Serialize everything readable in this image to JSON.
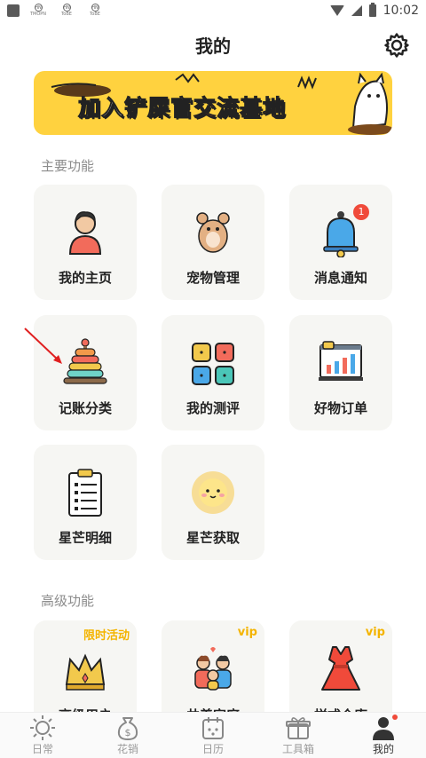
{
  "status_bar": {
    "time": "10:02",
    "mini1": "HN",
    "mini1_label": "TMOPN",
    "mini2": "HN",
    "mini2_label": "ToBE",
    "mini3": "HN",
    "mini3_label": "ToBE"
  },
  "header": {
    "title": "我的"
  },
  "banner": {
    "text_part1": "加入铲屎官",
    "text_part2": "交流基地"
  },
  "sections": {
    "main": "主要功能",
    "advanced": "高级功能"
  },
  "main_items": [
    {
      "label": "我的主页",
      "icon": "user-icon"
    },
    {
      "label": "宠物管理",
      "icon": "hamster-icon"
    },
    {
      "label": "消息通知",
      "icon": "bell-icon",
      "badge": "1"
    },
    {
      "label": "记账分类",
      "icon": "ring-stack-icon"
    },
    {
      "label": "我的测评",
      "icon": "grid-squares-icon"
    },
    {
      "label": "好物订单",
      "icon": "chart-board-icon"
    },
    {
      "label": "星芒明细",
      "icon": "clipboard-icon"
    },
    {
      "label": "星芒获取",
      "icon": "sun-icon"
    }
  ],
  "advanced_items": [
    {
      "label": "高级用户",
      "icon": "crown-icon",
      "tag": "限时活动"
    },
    {
      "label": "共养家庭",
      "icon": "family-icon",
      "tag": "vip"
    },
    {
      "label": "样式仓库",
      "icon": "dress-icon",
      "tag": "vip"
    }
  ],
  "bottom_nav": [
    {
      "label": "日常",
      "icon": "sun-outline-icon"
    },
    {
      "label": "花销",
      "icon": "money-bag-icon"
    },
    {
      "label": "日历",
      "icon": "calendar-icon"
    },
    {
      "label": "工具箱",
      "icon": "gift-box-icon"
    },
    {
      "label": "我的",
      "icon": "profile-icon"
    }
  ],
  "colors": {
    "accent": "#ffd23f",
    "badge": "#f04a3a",
    "tag": "#f4b400",
    "tile": "#f6f6f3"
  }
}
